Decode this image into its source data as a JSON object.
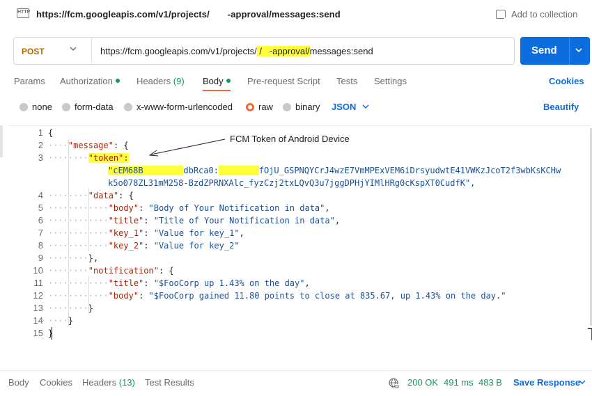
{
  "header": {
    "badge_text": "HTTP",
    "title_part1": "https://fcm.googleapis.com/v1/projects/",
    "title_part2": "-approval/messages:send",
    "add_collection": "Add to collection"
  },
  "request": {
    "method": "POST",
    "url_prefix": "https://fcm.googleapis.com/v1/projects/",
    "url_highlight": "/",
    "url_highlight2": "-approval/",
    "url_suffix": "messages:send",
    "send_label": "Send"
  },
  "tabs": {
    "params": "Params",
    "authorization": "Authorization",
    "headers": "Headers",
    "headers_count": "(9)",
    "body": "Body",
    "prerequest": "Pre-request Script",
    "tests": "Tests",
    "settings": "Settings",
    "cookies": "Cookies"
  },
  "body_options": {
    "none": "none",
    "form_data": "form-data",
    "urlencoded": "x-www-form-urlencoded",
    "raw": "raw",
    "binary": "binary",
    "format": "JSON",
    "beautify": "Beautify"
  },
  "editor": {
    "line_numbers": [
      "1",
      "2",
      "3",
      "4",
      "5",
      "6",
      "7",
      "8",
      "9",
      "10",
      "11",
      "12",
      "13",
      "14",
      "15"
    ],
    "annotation": "FCM Token of Android Device",
    "token_line1_a": "\"cEM68B",
    "token_line1_b": "dbRca0:",
    "token_line1_c": "fOjU_GSPNQYCrJ4wzE7VmMPExVEM6iDrsyudwtE41VWKzJcoT2f3wbKsKCHw",
    "token_line2": "k5o078ZL31mM258-BzdZPRNXAlc_fyzCzj2txLQvQ3u7jggDPHjYIMlHRg0cKspXT0CudfK\",",
    "keys": {
      "message": "\"message\"",
      "token": "\"token\":",
      "data": "\"data\"",
      "body": "\"body\"",
      "title": "\"title\"",
      "key_1": "\"key_1\"",
      "key_2": "\"key_2\"",
      "notification": "\"notification\""
    },
    "values": {
      "data_body": "\"Body of Your Notification in data\"",
      "data_title": "\"Title of Your Notification in data\"",
      "data_key_1": "\"Value for key_1\"",
      "data_key_2": "\"Value for key_2\"",
      "notif_title": "\"$FooCorp up 1.43% on the day\"",
      "notif_body": "\"$FooCorp gained 11.80 points to close at 835.67, up 1.43% on the day.\""
    }
  },
  "status": {
    "body": "Body",
    "cookies": "Cookies",
    "headers": "Headers",
    "headers_count": "(13)",
    "test_results": "Test Results",
    "code": "200 OK",
    "time": "491 ms",
    "size": "483 B",
    "save_response": "Save Response"
  },
  "colors": {
    "accent_blue": "#0c6ddf",
    "accent_orange": "#f26b3a",
    "success_green": "#0f9d58",
    "method_post": "#b36b00",
    "highlight_yellow": "#ffff3b"
  }
}
